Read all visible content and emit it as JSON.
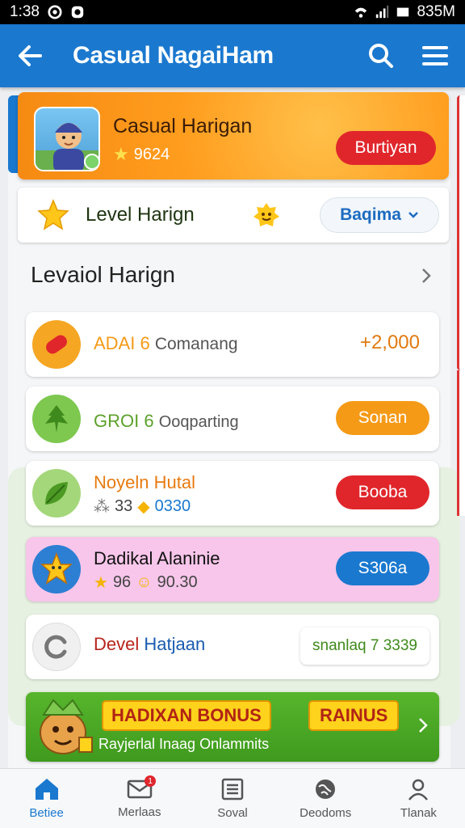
{
  "status_bar": {
    "time": "1:38",
    "right_text": "835M"
  },
  "app_bar": {
    "title": "Casual NagaiHam"
  },
  "hero": {
    "name": "Casual Harigan",
    "score": "9624",
    "button_label": "Burtiyan"
  },
  "level_bar": {
    "label": "Level Harign",
    "dropdown_value": "Baqima"
  },
  "section": {
    "title": "Levaiol Harign"
  },
  "cards": [
    {
      "title": "ADAI 6",
      "subtitle": "Comanang",
      "action": "+2,000",
      "accent": "#f59a17"
    },
    {
      "title": "GROI 6",
      "subtitle": "Ooqparting",
      "action": "Sonan",
      "accent": "#5ca12a"
    },
    {
      "title": "Noyeln Hutal",
      "sub_a": "33",
      "sub_b": "0330",
      "action": "Booba",
      "accent": "#e0262b"
    },
    {
      "title": "Dadikal Alaninie",
      "sub_a": "96",
      "sub_b": "90.30",
      "action": "S306a",
      "accent": "#1a78cf"
    },
    {
      "title_a": "Devel",
      "title_b": "Hatjaan",
      "action": "snanlaq 7 3339"
    }
  ],
  "bonus": {
    "tag1": "HADIXAN BONUS",
    "tag2": "RAINUS",
    "subtitle": "Rayjerlal Inaag Onlammits"
  },
  "bottom_nav": [
    {
      "label": "Betiee",
      "icon": "home-icon",
      "active": true
    },
    {
      "label": "Merlaas",
      "icon": "mail-icon",
      "badge": "1"
    },
    {
      "label": "Soval",
      "icon": "document-icon"
    },
    {
      "label": "Deodoms",
      "icon": "globe-icon"
    },
    {
      "label": "Tlanak",
      "icon": "profile-icon"
    }
  ],
  "colors": {
    "primary": "#1a78cf",
    "danger": "#e0262b",
    "orange": "#f59a17",
    "green": "#5ca12a",
    "highlight_card": "#f7c6ea"
  }
}
